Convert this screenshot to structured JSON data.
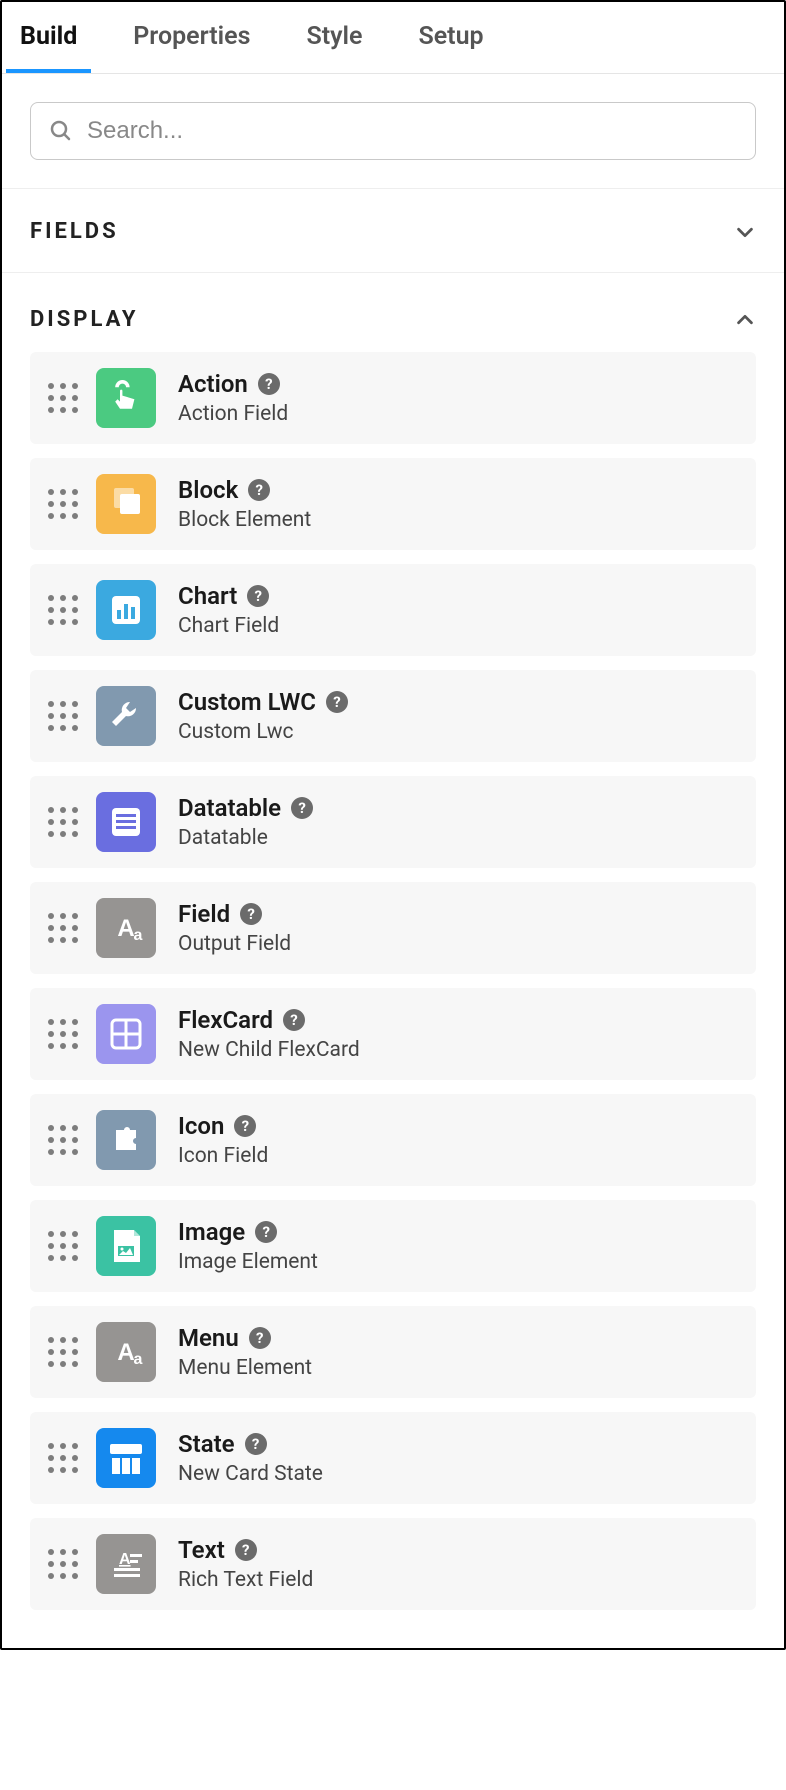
{
  "tabs": [
    {
      "label": "Build",
      "active": true
    },
    {
      "label": "Properties",
      "active": false
    },
    {
      "label": "Style",
      "active": false
    },
    {
      "label": "Setup",
      "active": false
    }
  ],
  "search": {
    "placeholder": "Search..."
  },
  "sections": {
    "fields": {
      "title": "FIELDS",
      "expanded": false
    },
    "display": {
      "title": "DISPLAY",
      "expanded": true
    }
  },
  "display_items": [
    {
      "title": "Action",
      "sub": "Action Field",
      "icon": "touch",
      "color": "#4bca81"
    },
    {
      "title": "Block",
      "sub": "Block Element",
      "icon": "copy",
      "color": "#f7b84b"
    },
    {
      "title": "Chart",
      "sub": "Chart Field",
      "icon": "chart",
      "color": "#3ba9e0"
    },
    {
      "title": "Custom LWC",
      "sub": "Custom Lwc",
      "icon": "wrench",
      "color": "#8199af"
    },
    {
      "title": "Datatable",
      "sub": "Datatable",
      "icon": "table",
      "color": "#6a6ee0"
    },
    {
      "title": "Field",
      "sub": "Output Field",
      "icon": "aa",
      "color": "#969492"
    },
    {
      "title": "FlexCard",
      "sub": "New Child FlexCard",
      "icon": "grid",
      "color": "#9b95ee"
    },
    {
      "title": "Icon",
      "sub": "Icon Field",
      "icon": "puzzle",
      "color": "#8199af"
    },
    {
      "title": "Image",
      "sub": "Image Element",
      "icon": "image",
      "color": "#3bc2a3"
    },
    {
      "title": "Menu",
      "sub": "Menu Element",
      "icon": "aa",
      "color": "#969492"
    },
    {
      "title": "State",
      "sub": "New Card State",
      "icon": "columns",
      "color": "#1589ee"
    },
    {
      "title": "Text",
      "sub": "Rich Text Field",
      "icon": "textlines",
      "color": "#969492"
    }
  ],
  "help_glyph": "?"
}
